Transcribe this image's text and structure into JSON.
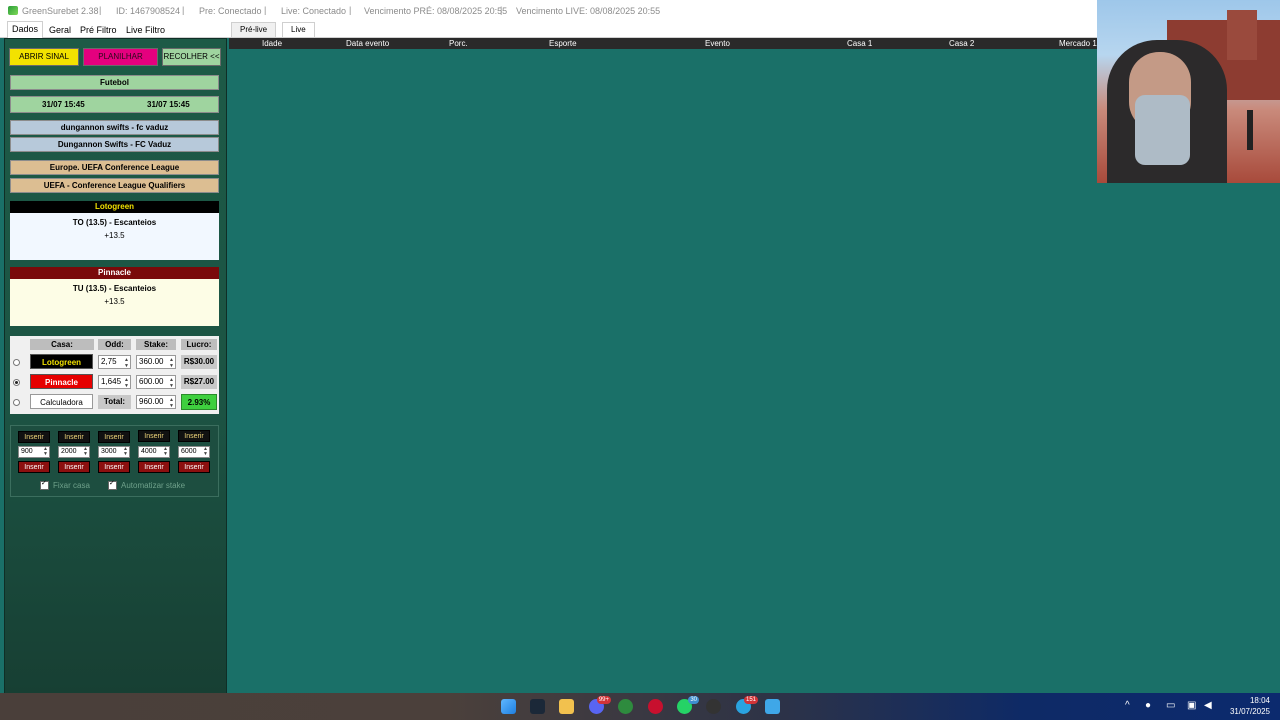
{
  "titlebar": {
    "app_name": "GreenSurebet 2.38",
    "id": "ID: 1467908524",
    "pre_status": "Pre: Conectado",
    "live_status": "Live: Conectado",
    "venc_pre": "Vencimento PRÉ: 08/08/2025 20:55",
    "venc_live": "Vencimento LIVE: 08/08/2025 20:55",
    "separator": "|"
  },
  "left_tabs": [
    "Dados",
    "Geral",
    "Pré Filtro",
    "Live Filtro"
  ],
  "right_tabs": [
    "Pré-live",
    "Live"
  ],
  "buttons": {
    "abrir_sinal": "ABRIR SINAL",
    "planilhar": "PLANILHAR",
    "recolher": "RECOLHER <<"
  },
  "signal": {
    "sport": "Futebol",
    "date1": "31/07 15:45",
    "date2": "31/07 15:45",
    "event1": "dungannon swifts - fc vaduz",
    "event2": "Dungannon Swifts - FC Vaduz",
    "league1": "Europe. UEFA Conference League",
    "league2": "UEFA - Conference League Qualifiers"
  },
  "market1": {
    "house": "Lotogreen",
    "line1": "TO (13.5) - Escanteios",
    "line2": "+13.5"
  },
  "market2": {
    "house": "Pinnacle",
    "line1": "TU (13.5) - Escanteios",
    "line2": "+13.5"
  },
  "calc": {
    "headers": {
      "casa": "Casa:",
      "odd": "Odd:",
      "stake": "Stake:",
      "lucro": "Lucro:"
    },
    "rows": [
      {
        "house": "Lotogreen",
        "odd": "2,75",
        "stake": "360.00",
        "lucro": "R$30.00"
      },
      {
        "house": "Pinnacle",
        "odd": "1,645",
        "stake": "600.00",
        "lucro": "R$27.00"
      }
    ],
    "calculadora": "Calculadora",
    "total_label": "Total:",
    "total_value": "960.00",
    "percent": "2.93%"
  },
  "insert": {
    "label": "Inserir",
    "values": [
      "900",
      "2000",
      "3000",
      "4000",
      "6000"
    ],
    "fixar_casa": "Fixar casa",
    "automatizar_stake": "Automatizar stake"
  },
  "table": {
    "columns": [
      "Idade",
      "Data evento",
      "Porc.",
      "Esporte",
      "Evento",
      "Casa 1",
      "Casa 2",
      "Mercado 1"
    ]
  },
  "taskbar": {
    "badges": [
      "99+",
      "30",
      "151"
    ],
    "time": "18:04",
    "date": "31/07/2025"
  },
  "colors": {
    "table_bg": "#1a7068",
    "abrir_sinal": "#f2e200",
    "planilhar": "#e4007e",
    "recolher": "#9fd49f",
    "lotogreen_header": "#000000",
    "pinnacle_header": "#7a0a0a",
    "pinnacle_button": "#e60000",
    "percent": "#3ecf3e"
  }
}
